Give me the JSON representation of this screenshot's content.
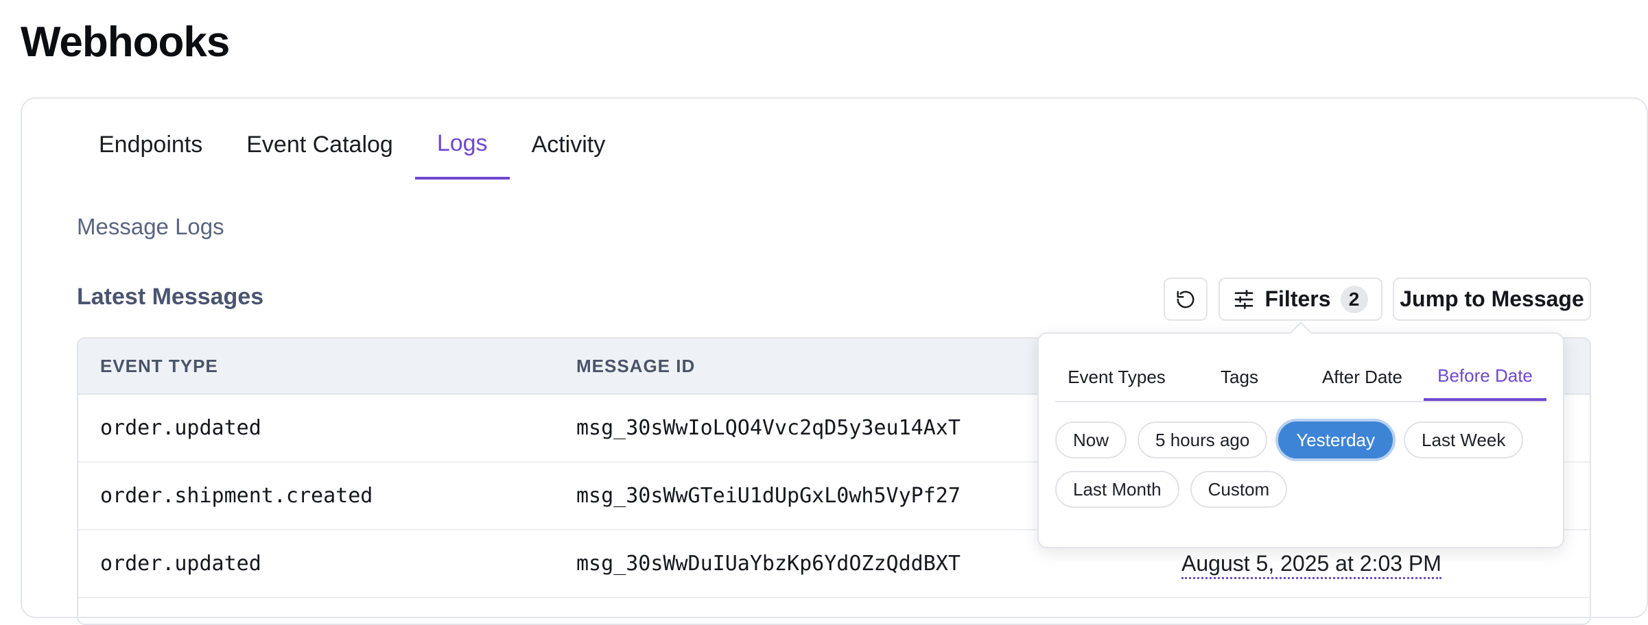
{
  "page": {
    "title": "Webhooks"
  },
  "tabs": [
    {
      "label": "Endpoints",
      "active": false
    },
    {
      "label": "Event Catalog",
      "active": false
    },
    {
      "label": "Logs",
      "active": true
    },
    {
      "label": "Activity",
      "active": false
    }
  ],
  "section_label": "Message Logs",
  "latest": {
    "title": "Latest Messages",
    "refresh_icon": "refresh-icon",
    "filters_label": "Filters",
    "filters_icon": "sliders-icon",
    "filters_count": "2",
    "jump_label": "Jump to Message"
  },
  "table": {
    "headers": [
      "EVENT TYPE",
      "MESSAGE ID"
    ],
    "rows": [
      {
        "event_type": "order.updated",
        "message_id": "msg_30sWwIoLQO4Vvc2qD5y3eu14AxT",
        "date": ""
      },
      {
        "event_type": "order.shipment.created",
        "message_id": "msg_30sWwGTeiU1dUpGxL0wh5VyPf27",
        "date": ""
      },
      {
        "event_type": "order.updated",
        "message_id": "msg_30sWwDuIUaYbzKp6YdOZzQddBXT",
        "date": "August 5, 2025 at 2:03 PM"
      }
    ]
  },
  "filters_popover": {
    "tabs": [
      {
        "label": "Event Types",
        "active": false
      },
      {
        "label": "Tags",
        "active": false
      },
      {
        "label": "After Date",
        "active": false
      },
      {
        "label": "Before Date",
        "active": true
      }
    ],
    "options": [
      {
        "label": "Now",
        "selected": false
      },
      {
        "label": "5 hours ago",
        "selected": false
      },
      {
        "label": "Yesterday",
        "selected": true
      },
      {
        "label": "Last Week",
        "selected": false
      },
      {
        "label": "Last Month",
        "selected": false
      },
      {
        "label": "Custom",
        "selected": false
      }
    ]
  },
  "colors": {
    "accent": "#7048d0",
    "selected_chip": "#3d84d6",
    "header_bg": "#eef1f5"
  }
}
